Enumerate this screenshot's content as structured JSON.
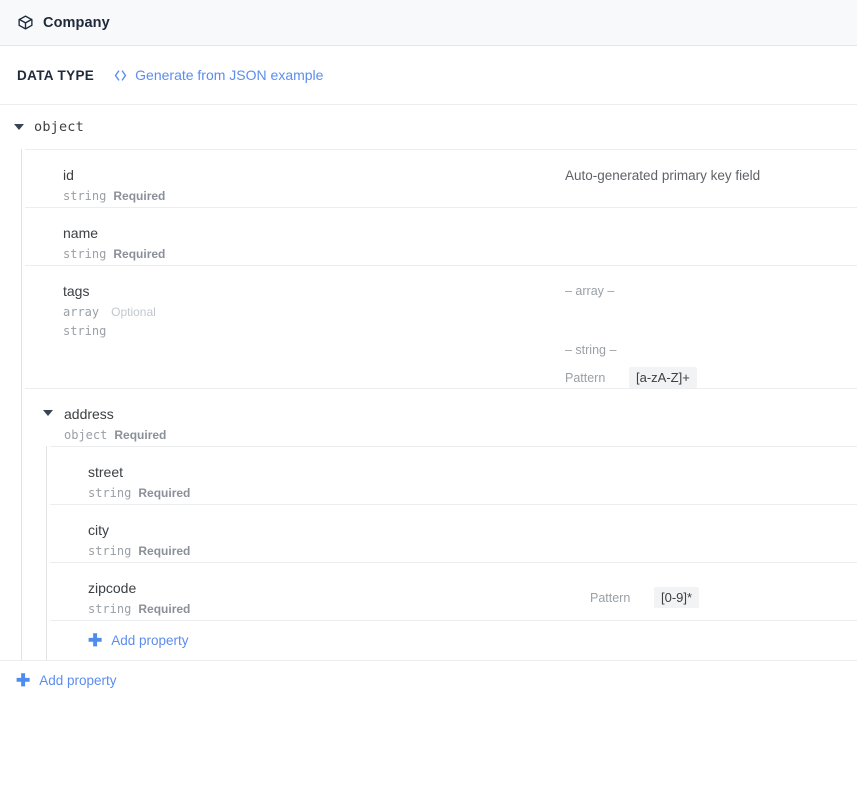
{
  "header": {
    "icon": "cube-icon",
    "title": "Company"
  },
  "datatype_bar": {
    "label": "DATA TYPE",
    "generate_link": {
      "icon": "code-brackets-icon",
      "text": "Generate from JSON example"
    }
  },
  "root": {
    "type_label": "object",
    "expanded": true,
    "caret_icon": "caret-down-icon"
  },
  "properties": [
    {
      "name": "id",
      "type": "string",
      "requirement": "Required",
      "description": "Auto-generated primary key field"
    },
    {
      "name": "name",
      "type": "string",
      "requirement": "Required",
      "description": ""
    },
    {
      "name": "tags",
      "type": "array",
      "requirement": "Optional",
      "subtype": "string",
      "array_separator": "– array –",
      "item_separator": "– string –",
      "constraint_label": "Pattern",
      "constraint_value": "[a-zA-Z]+"
    },
    {
      "name": "address",
      "type": "object",
      "requirement": "Required",
      "expanded": true,
      "caret_icon": "caret-down-icon",
      "children": [
        {
          "name": "street",
          "type": "string",
          "requirement": "Required"
        },
        {
          "name": "city",
          "type": "string",
          "requirement": "Required"
        },
        {
          "name": "zipcode",
          "type": "string",
          "requirement": "Required",
          "constraint_label": "Pattern",
          "constraint_value": "[0-9]*"
        }
      ],
      "add_property": {
        "icon": "plus-icon",
        "label": "Add property"
      }
    }
  ],
  "root_add_property": {
    "icon": "plus-icon",
    "label": "Add property"
  },
  "colors": {
    "accent_link": "#5b8def",
    "header_bg": "#f8f9fa",
    "text_primary": "#3c4043",
    "text_muted": "#9aa0a6",
    "chip_bg": "#f1f3f4",
    "border": "#ebedef"
  }
}
